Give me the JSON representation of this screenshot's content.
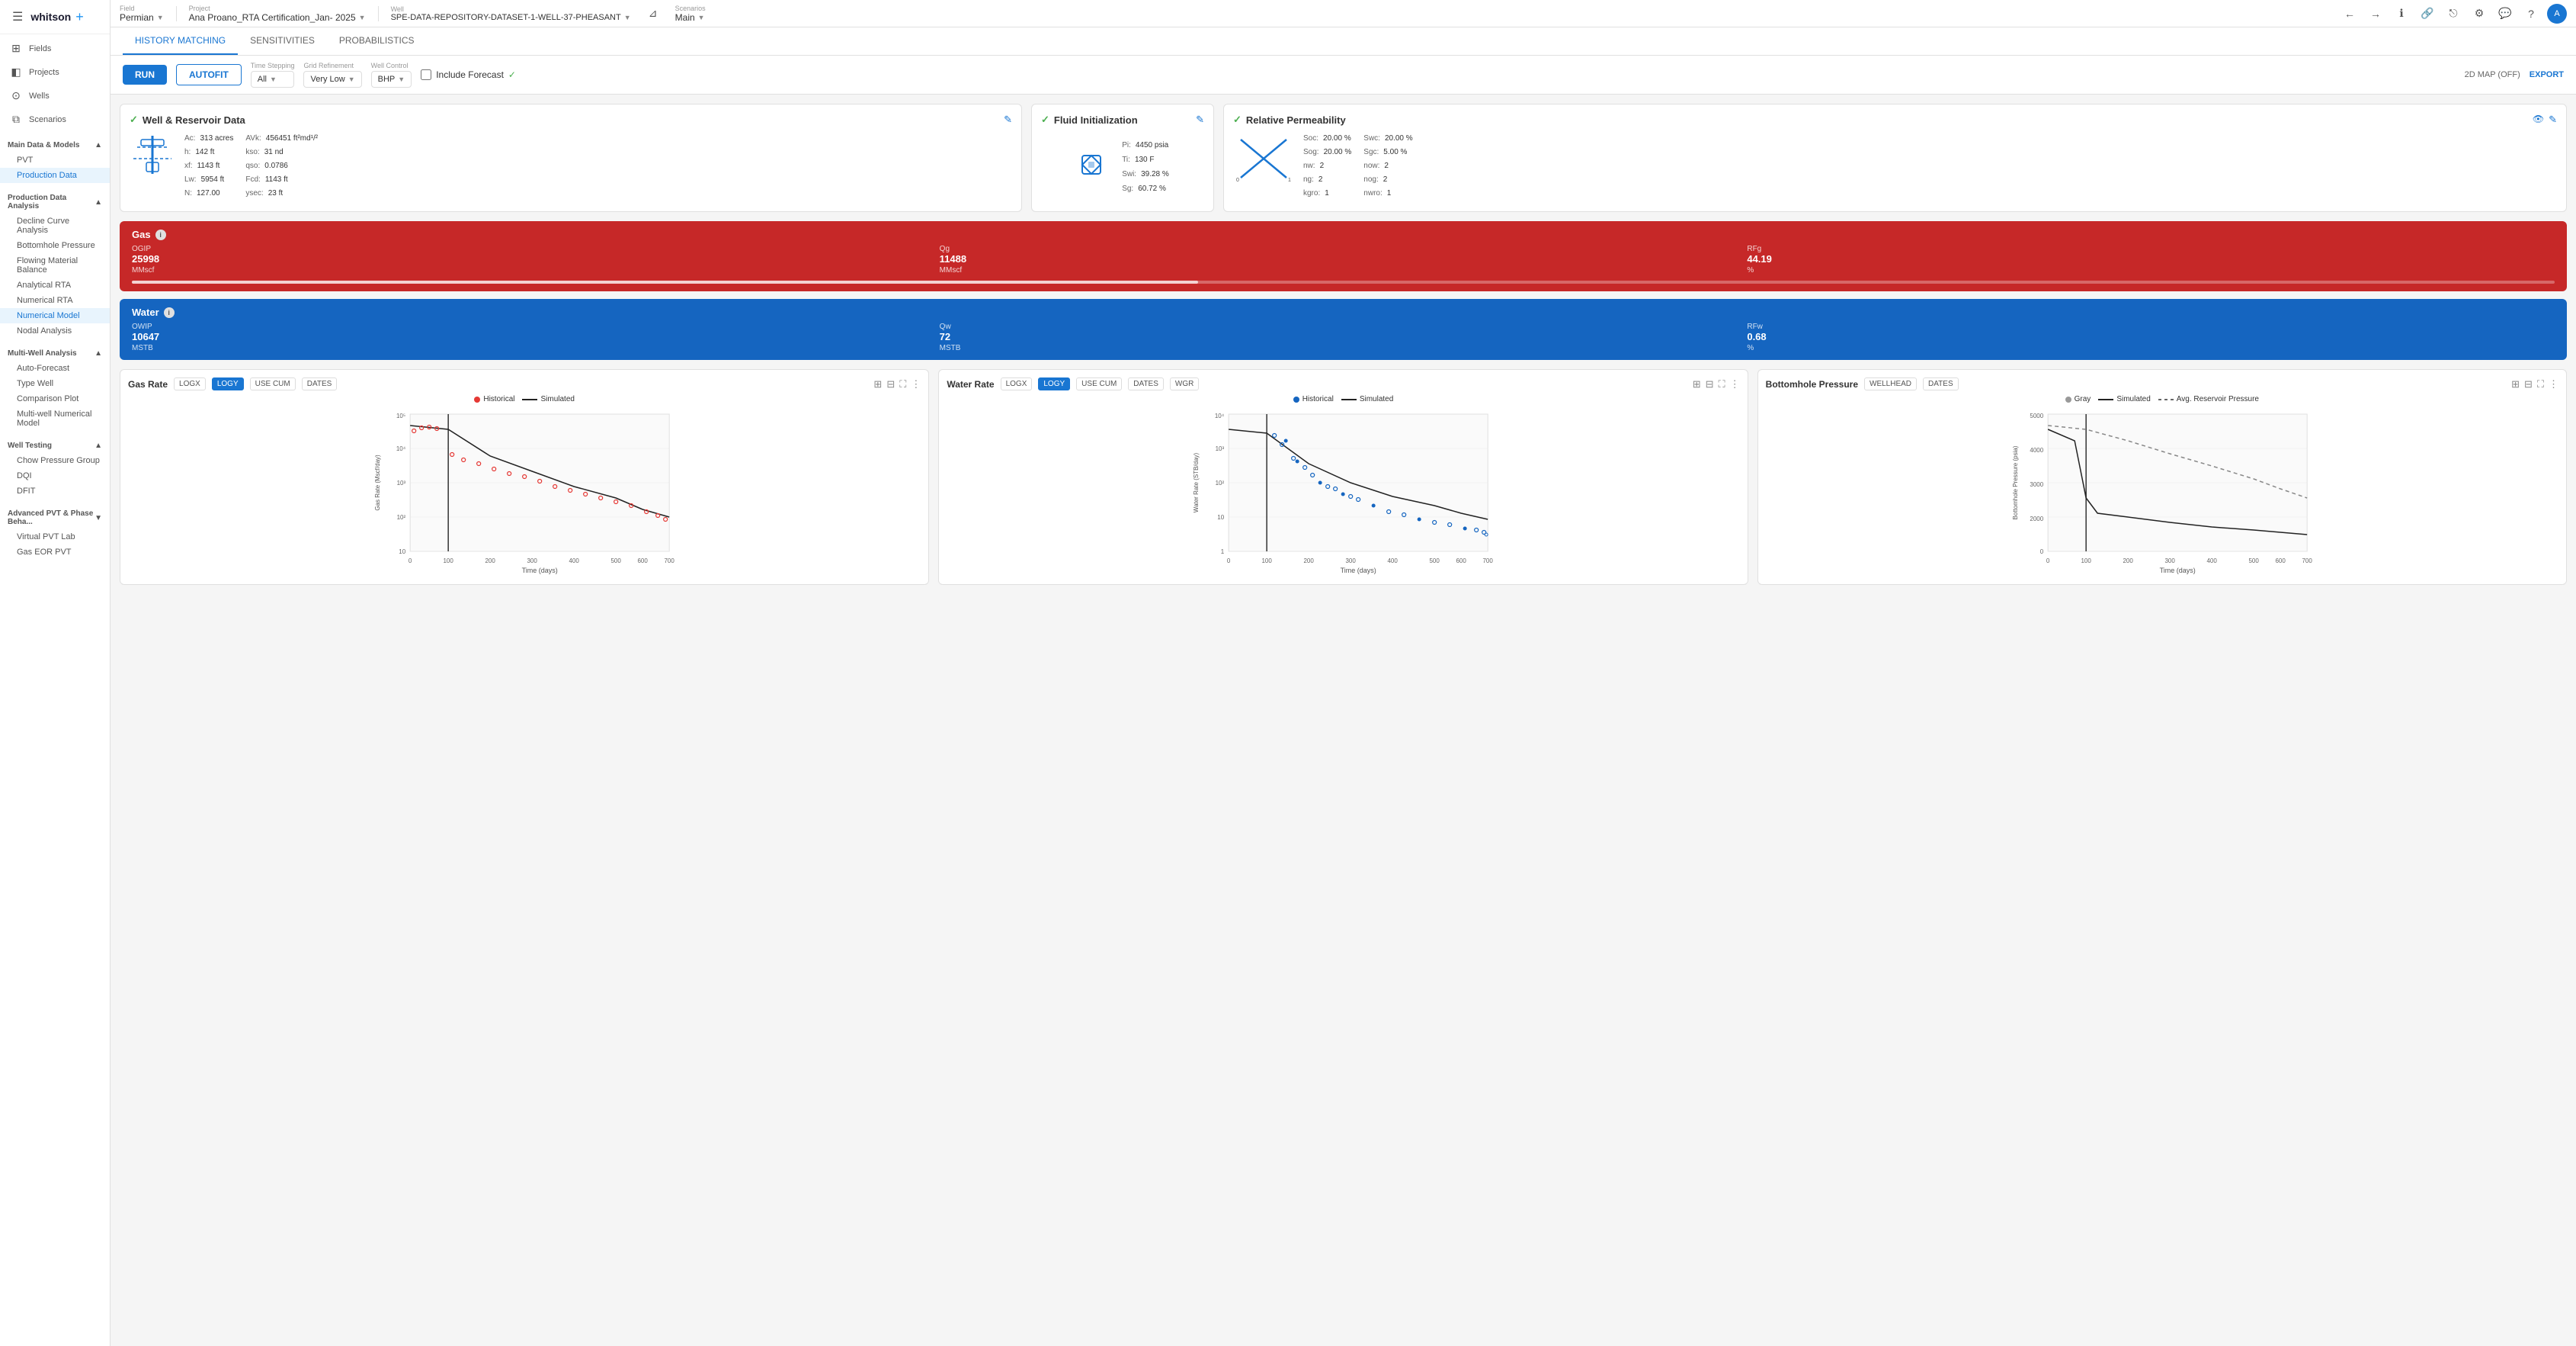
{
  "brand": {
    "name": "whitson",
    "plus": "+"
  },
  "topbar": {
    "field_label": "Field",
    "field_value": "Permian",
    "project_label": "Project",
    "project_value": "Ana Proano_RTA Certification_Jan- 2025",
    "well_label": "Well",
    "well_value": "SPE-DATA-REPOSITORY-DATASET-1-WELL-37-PHEASANT",
    "scenarios_label": "Scenarios",
    "scenarios_value": "Main"
  },
  "tabs": [
    {
      "id": "history-matching",
      "label": "HISTORY MATCHING",
      "active": true
    },
    {
      "id": "sensitivities",
      "label": "SENSITIVITIES",
      "active": false
    },
    {
      "id": "probabilistics",
      "label": "PROBABILISTICS",
      "active": false
    }
  ],
  "toolbar": {
    "run_label": "RUN",
    "autofit_label": "AUTOFIT",
    "time_stepping_label": "Time Stepping",
    "time_stepping_value": "All",
    "grid_refinement_label": "Grid Refinement",
    "grid_refinement_value": "Very Low",
    "well_control_label": "Well Control",
    "well_control_value": "BHP",
    "include_forecast_label": "Include Forecast",
    "include_forecast_checked": false,
    "map_label": "2D MAP (OFF)",
    "export_label": "EXPORT"
  },
  "sidebar": {
    "fields_label": "Fields",
    "projects_label": "Projects",
    "wells_label": "Wells",
    "scenarios_label": "Scenarios",
    "main_data_section": "Main Data & Models",
    "pvt_label": "PVT",
    "production_data_label": "Production Data",
    "production_data_analysis_section": "Production Data Analysis",
    "decline_curve_label": "Decline Curve Analysis",
    "bottomhole_label": "Bottomhole Pressure",
    "flowing_material_label": "Flowing Material Balance",
    "analytical_rta_label": "Analytical RTA",
    "numerical_rta_label": "Numerical RTA",
    "numerical_model_label": "Numerical Model",
    "nodal_analysis_label": "Nodal Analysis",
    "multi_well_section": "Multi-Well Analysis",
    "auto_forecast_label": "Auto-Forecast",
    "type_well_label": "Type Well",
    "comparison_plot_label": "Comparison Plot",
    "multi_well_numerical_label": "Multi-well Numerical Model",
    "well_testing_section": "Well Testing",
    "chow_pressure_label": "Chow Pressure Group",
    "dqi_label": "DQI",
    "dfit_label": "DFIT",
    "advanced_pvt_section": "Advanced PVT & Phase Beha...",
    "virtual_pvt_label": "Virtual PVT Lab",
    "gas_eor_label": "Gas EOR PVT"
  },
  "well_reservoir": {
    "title": "Well & Reservoir Data",
    "data": {
      "Ac": "313 acres",
      "h": "142 ft",
      "xf": "1143 ft",
      "Lw": "5954 ft",
      "N": "127.00",
      "Avk": "456451 ft²md¹/²",
      "kso": "31 nd",
      "qso": "0.0786",
      "Fcd": "1143 ft",
      "ysec": "23 ft"
    }
  },
  "fluid_init": {
    "title": "Fluid Initialization",
    "Pi": "4450 psia",
    "Ti": "130 F",
    "Swi": "39.28 %",
    "Sg": "60.72 %"
  },
  "rel_perm": {
    "title": "Relative Permeability",
    "Soc": "20.00 %",
    "Sog": "20.00 %",
    "Swc": "20.00 %",
    "Sgc": "5.00 %",
    "nw": "2",
    "now": "2",
    "ng": "2",
    "nog": "2",
    "nwro": "1",
    "kgro": "1"
  },
  "gas_bar": {
    "title": "Gas",
    "OGIP_label": "OGIP",
    "OGIP_value": "25998",
    "OGIP_unit": "MMscf",
    "Qg_label": "Qg",
    "Qg_value": "11488",
    "Qg_unit": "MMscf",
    "RFg_label": "RFg",
    "RFg_value": "44.19",
    "RFg_unit": "%"
  },
  "water_bar": {
    "title": "Water",
    "OWIP_label": "OWIP",
    "OWIP_value": "10647",
    "OWIP_unit": "MSTB",
    "Qw_label": "Qw",
    "Qw_value": "72",
    "Qw_unit": "MSTB",
    "RFw_label": "RFw",
    "RFw_value": "0.68",
    "RFw_unit": "%"
  },
  "gas_chart": {
    "title": "Gas Rate",
    "buttons": [
      "LOGX",
      "LOGY",
      "USE CUM",
      "DATES"
    ],
    "active_button": "LOGY",
    "legend": {
      "historical": "Historical",
      "simulated": "Simulated"
    },
    "x_label": "Time (days)",
    "y_label": "Gas Rate (Mscf/day)"
  },
  "water_chart": {
    "title": "Water Rate",
    "buttons": [
      "LOGX",
      "LOGY",
      "USE CUM",
      "DATES",
      "WGR"
    ],
    "active_button": "LOGY",
    "legend": {
      "historical": "Historical",
      "simulated": "Simulated"
    },
    "x_label": "Time (days)",
    "y_label": "Water Rate (STB/day)"
  },
  "bhp_chart": {
    "title": "Bottomhole Pressure",
    "buttons": [
      "WELLHEAD",
      "DATES"
    ],
    "legend": {
      "gray": "Gray",
      "simulated": "Simulated",
      "avg_reservoir": "Avg. Reservoir Pressure"
    },
    "x_label": "Time (days)",
    "y_label": "Bottomhole Pressure (psia)"
  }
}
